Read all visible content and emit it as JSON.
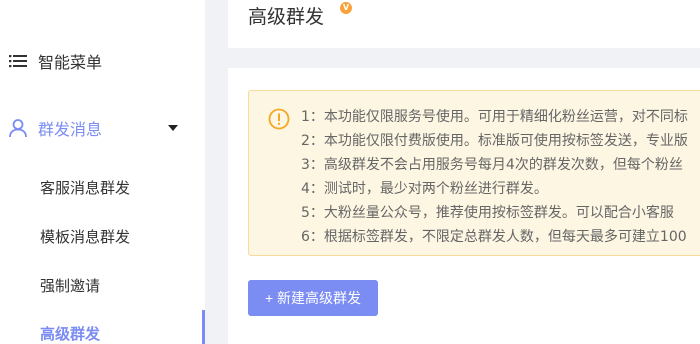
{
  "sidebar": {
    "top_item": {
      "label": "智能菜单",
      "icon": "list-icon"
    },
    "group": {
      "label": "群发消息",
      "icon": "user-icon",
      "expanded": true
    },
    "sub_items": [
      {
        "label": "客服消息群发",
        "active": false
      },
      {
        "label": "模板消息群发",
        "active": false
      },
      {
        "label": "强制邀请",
        "active": false
      },
      {
        "label": "高级群发",
        "active": true
      }
    ]
  },
  "header": {
    "title": "高级群发",
    "badge": "V"
  },
  "notice": {
    "icon": "warning-icon",
    "lines": [
      "1：本功能仅限服务号使用。可用于精细化粉丝运营，对不同标",
      "2：本功能仅限付费版使用。标准版可使用按标签发送，专业版",
      "3：高级群发不会占用服务号每月4次的群发次数，但每个粉丝",
      "4：测试时，最少对两个粉丝进行群发。",
      "5：大粉丝量公众号，推荐使用按标签群发。可以配合小客服",
      "6：根据标签群发，不限定总群发人数，但每天最多可建立100"
    ]
  },
  "actions": {
    "new_button": "+ 新建高级群发"
  },
  "colors": {
    "accent": "#7b8cf3",
    "notice_bg": "#fdf6e3",
    "notice_border": "#f5dc9b",
    "warning": "#f5a623",
    "badge": "#f7a23b"
  }
}
